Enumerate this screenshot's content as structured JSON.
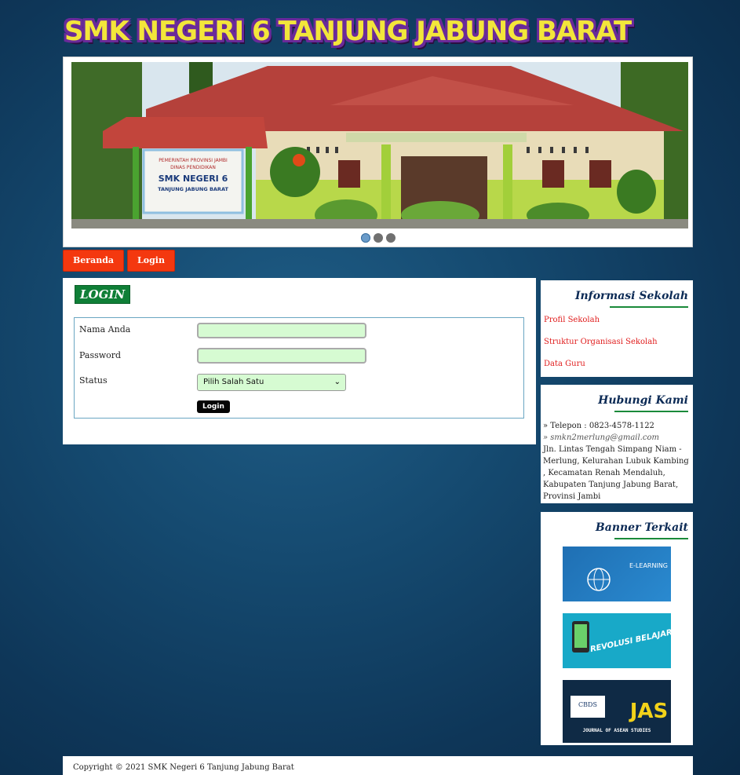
{
  "header": {
    "site_title": "SMK NEGERI 6 TANJUNG JABUNG BARAT"
  },
  "slider": {
    "sign_line1": "PEMERINTAH PROVINSI JAMBI",
    "sign_line2": "DINAS PENDIDIKAN",
    "sign_line3": "SMK NEGERI 6",
    "sign_line4": "TANJUNG JABUNG BARAT",
    "active_slide": 1,
    "slide_count": 3
  },
  "nav": {
    "items": [
      {
        "label": "Beranda"
      },
      {
        "label": "Login"
      }
    ]
  },
  "login": {
    "heading": "LOGIN",
    "name_label": "Nama Anda",
    "password_label": "Password",
    "status_label": "Status",
    "status_selected": "Pilih Salah Satu",
    "submit_label": "Login"
  },
  "info": {
    "title": "Informasi Sekolah",
    "links": [
      "Profil Sekolah",
      "Struktur Organisasi Sekolah",
      "Data Guru"
    ]
  },
  "contact": {
    "title": "Hubungi Kami",
    "phone": "» Telepon : 0823-4578-1122",
    "email": "» smkn2merlung@gmail.com",
    "address": "Jln. Lintas Tengah Simpang Niam - Merlung, Kelurahan Lubuk Kambing , Kecamatan Renah Mendaluh, Kabupaten Tanjung Jabung Barat, Provinsi Jambi"
  },
  "banners": {
    "title": "Banner Terkait",
    "b1_text": "E-LEARNING",
    "b2_text": "REVOLUSI BELAJAR",
    "b3_logo": "CBDS",
    "b3_big": "JAS",
    "b3_sub": "JOURNAL OF ASEAN STUDIES"
  },
  "footer": {
    "copyright": "Copyright © 2021 SMK Negeri 6 Tanjung Jabung Barat"
  },
  "colors": {
    "accent_red": "#f4380f",
    "accent_green": "#0f7f37",
    "input_bg": "#d6fbd2"
  }
}
